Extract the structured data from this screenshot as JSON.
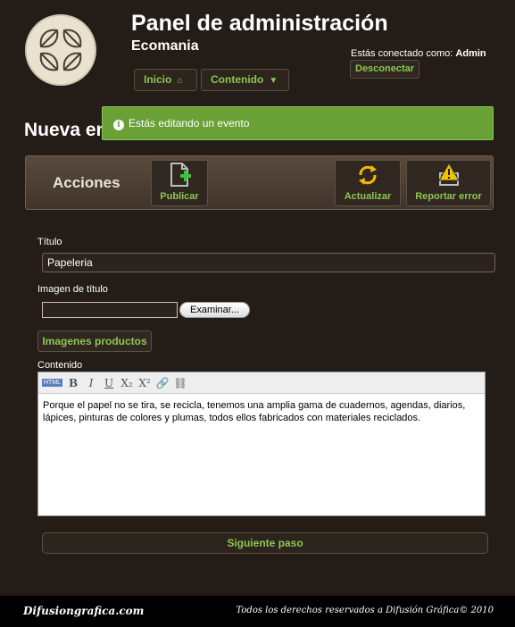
{
  "header": {
    "app_title": "Panel de administración",
    "app_subtitle": "Ecomania",
    "connected_as_label": "Estás conectado como:",
    "connected_user": "Admin",
    "logout_label": "Desconectar"
  },
  "nav": {
    "inicio_label": "Inicio",
    "contenido_label": "Contenido"
  },
  "page": {
    "title": "Nueva entrada"
  },
  "notice": {
    "text": "Estás editando un evento"
  },
  "actions": {
    "label": "Acciones",
    "publish_label": "Publicar",
    "refresh_label": "Actualizar",
    "report_label": "Reportar error"
  },
  "form": {
    "title_label": "Título",
    "title_value": "Papeleria",
    "image_label": "Imagen de título",
    "browse_label": "Examinar...",
    "product_images_label": "Imagenes productos",
    "content_label": "Contenido",
    "content_text": "Porque el papel no se tira, se recicla, tenemos una amplia gama de cuadernos, agendas, diarios, lápices, pinturas de colores y plumas, todos ellos fabricados con materiales reciclados.",
    "toolbar": {
      "html": "HTML",
      "bold": "B",
      "italic": "I",
      "underline": "U",
      "subscript": "X₂",
      "superscript": "X²",
      "link": "🔗",
      "unlink": "⛓"
    },
    "next_label": "Siguiente paso"
  },
  "footer": {
    "brand": "Difusiongrafica.com",
    "copyright": "Todos los derechos reservados a Difusión Gráfica© 2010"
  },
  "colors": {
    "background": "#231c17",
    "accent_green": "#8cc653",
    "notice_green": "#6aa137"
  }
}
